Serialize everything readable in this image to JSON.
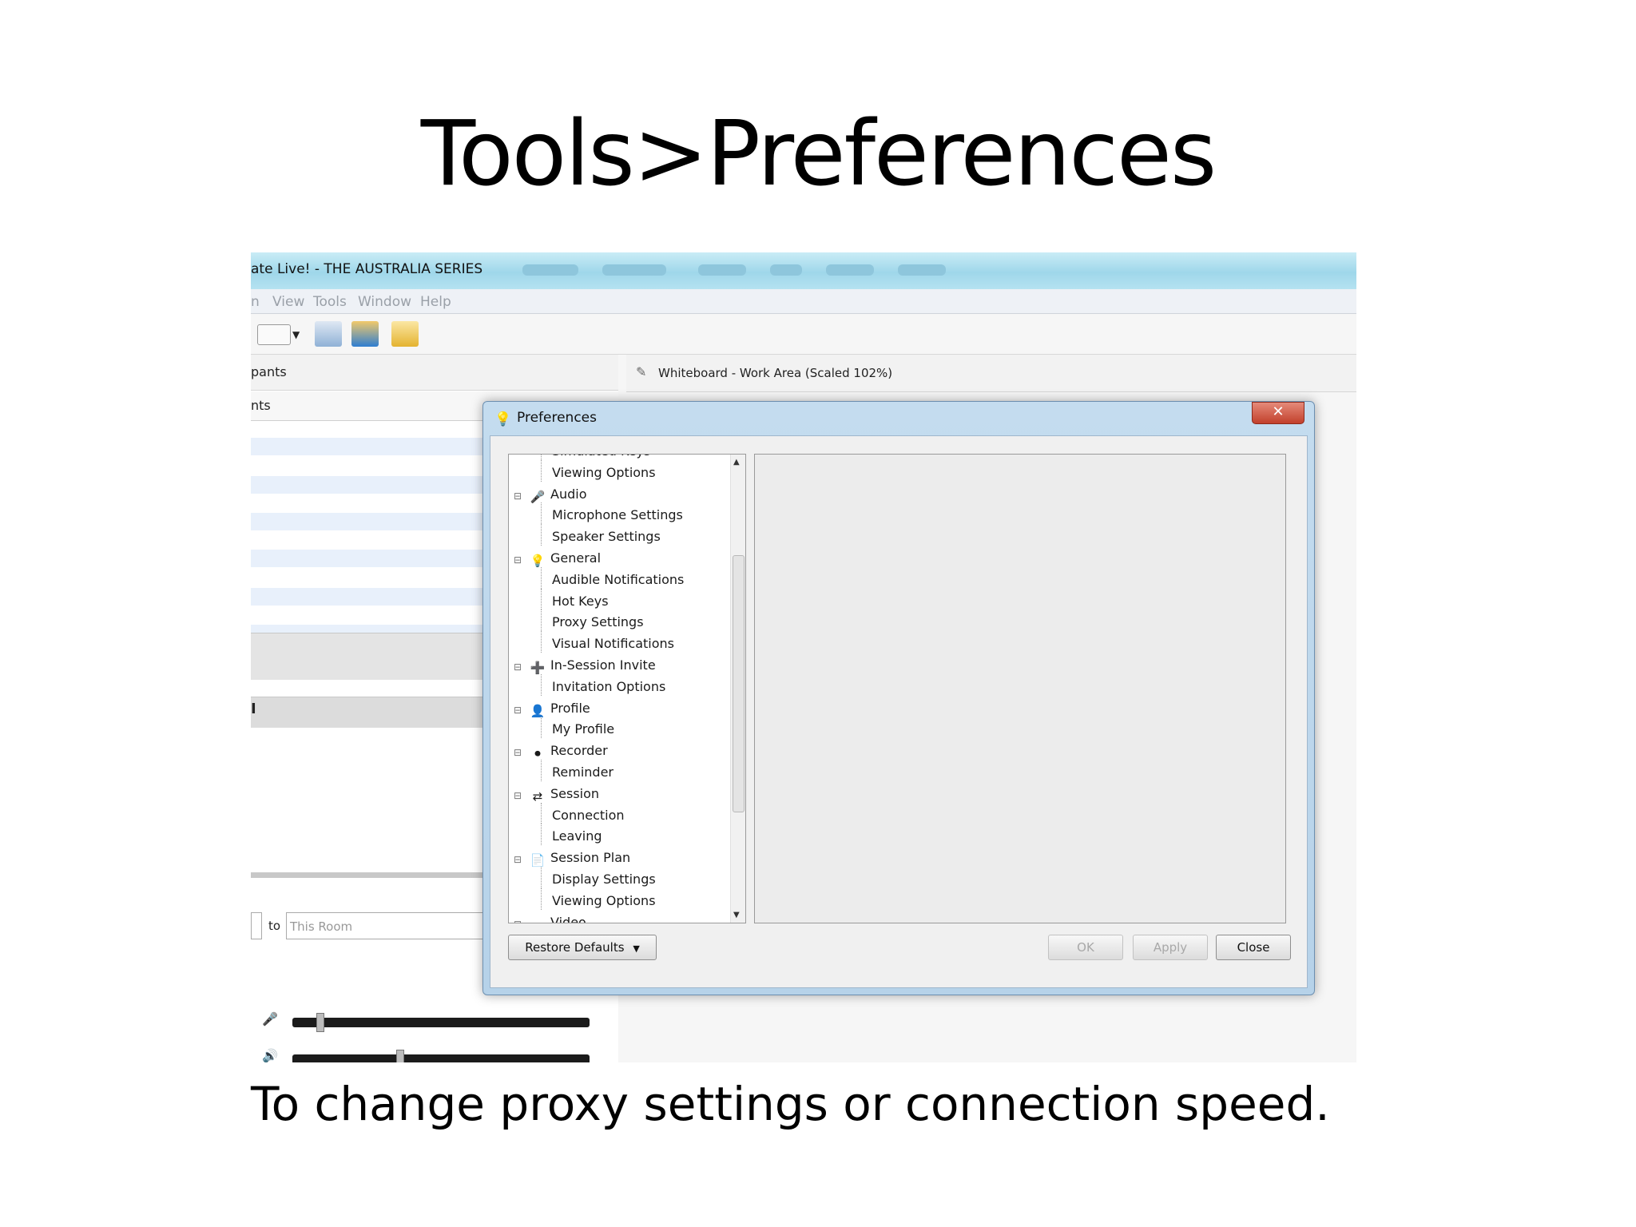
{
  "slide": {
    "title": "Tools>Preferences",
    "caption": "To change proxy settings or connection speed."
  },
  "app": {
    "window_title": "ate Live! - THE AUSTRALIA SERIES",
    "menu": [
      "n",
      "View",
      "Tools",
      "Window",
      "Help"
    ],
    "participants_header": "pants",
    "participants_subheader": "nts",
    "whiteboard_title": "Whiteboard - Work Area (Scaled 102%)",
    "to_label": "to",
    "to_placeholder": "This Room",
    "hidden_row_marker": "I"
  },
  "dialog": {
    "title": "Preferences",
    "close_glyph": "✕",
    "tree": [
      {
        "label": "Simulated Keys",
        "level": 1
      },
      {
        "label": "Viewing Options",
        "level": 1
      },
      {
        "label": "Audio",
        "level": 0,
        "icon": "microphone-icon",
        "glyph": "🎤"
      },
      {
        "label": "Microphone Settings",
        "level": 1
      },
      {
        "label": "Speaker Settings",
        "level": 1
      },
      {
        "label": "General",
        "level": 0,
        "icon": "bulb-icon",
        "glyph": "💡"
      },
      {
        "label": "Audible Notifications",
        "level": 1
      },
      {
        "label": "Hot Keys",
        "level": 1
      },
      {
        "label": "Proxy Settings",
        "level": 1
      },
      {
        "label": "Visual Notifications",
        "level": 1
      },
      {
        "label": "In-Session Invite",
        "level": 0,
        "icon": "invite-icon",
        "glyph": "➕"
      },
      {
        "label": "Invitation Options",
        "level": 1
      },
      {
        "label": "Profile",
        "level": 0,
        "icon": "person-icon",
        "glyph": "👤"
      },
      {
        "label": "My Profile",
        "level": 1
      },
      {
        "label": "Recorder",
        "level": 0,
        "icon": "recorder-icon",
        "glyph": "⏺"
      },
      {
        "label": "Reminder",
        "level": 1
      },
      {
        "label": "Session",
        "level": 0,
        "icon": "session-icon",
        "glyph": "⇄"
      },
      {
        "label": "Connection",
        "level": 1
      },
      {
        "label": "Leaving",
        "level": 1
      },
      {
        "label": "Session Plan",
        "level": 0,
        "icon": "document-icon",
        "glyph": "📄"
      },
      {
        "label": "Display Settings",
        "level": 1
      },
      {
        "label": "Viewing Options",
        "level": 1
      },
      {
        "label": "Video",
        "level": 0,
        "icon": "video-icon",
        "glyph": "•"
      }
    ],
    "buttons": {
      "restore": "Restore Defaults",
      "ok": "OK",
      "apply": "Apply",
      "close": "Close"
    }
  },
  "colors": {
    "titlebar": "#9fd7ea",
    "dialog_frame": "#b6d2e9",
    "close_button": "#c2402b"
  }
}
